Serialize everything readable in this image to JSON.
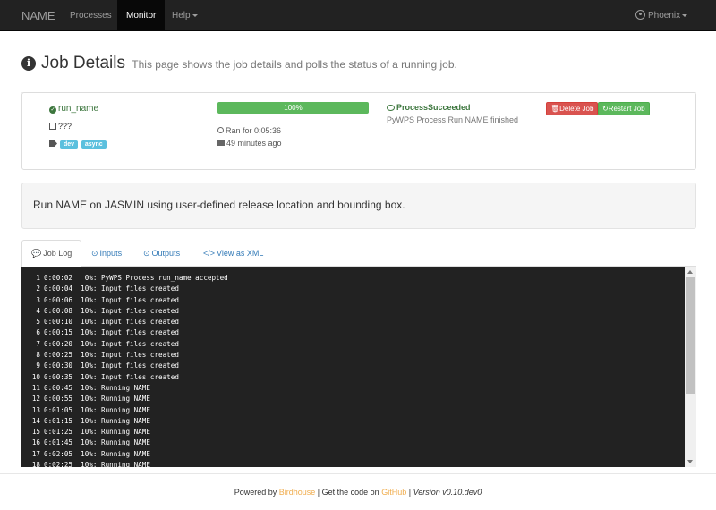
{
  "navbar": {
    "brand": "NAME",
    "processes": "Processes",
    "monitor": "Monitor",
    "help": "Help",
    "user": "Phoenix"
  },
  "header": {
    "title": "Job Details",
    "subtitle": "This page shows the job details and polls the status of a running job."
  },
  "job": {
    "name": "run_name",
    "abstract": "???",
    "tags": [
      "dev",
      "async"
    ],
    "progress": 100,
    "progress_label": "100%",
    "duration": "Ran for 0:05:36",
    "created": "49 minutes ago",
    "status": "ProcessSucceeded",
    "status_message": "PyWPS Process Run NAME finished",
    "delete_label": "Delete Job",
    "restart_label": "Restart Job"
  },
  "description": "Run NAME on JASMIN using user-defined release location and bounding box.",
  "tabs": {
    "log": "Job Log",
    "inputs": "Inputs",
    "outputs": "Outputs",
    "xml": "View as XML"
  },
  "log": [
    {
      "n": "1",
      "time": "0:00:02",
      "msg": " 0%: PyWPS Process run_name accepted"
    },
    {
      "n": "2",
      "time": "0:00:04",
      "msg": "10%: Input files created"
    },
    {
      "n": "3",
      "time": "0:00:06",
      "msg": "10%: Input files created"
    },
    {
      "n": "4",
      "time": "0:00:08",
      "msg": "10%: Input files created"
    },
    {
      "n": "5",
      "time": "0:00:10",
      "msg": "10%: Input files created"
    },
    {
      "n": "6",
      "time": "0:00:15",
      "msg": "10%: Input files created"
    },
    {
      "n": "7",
      "time": "0:00:20",
      "msg": "10%: Input files created"
    },
    {
      "n": "8",
      "time": "0:00:25",
      "msg": "10%: Input files created"
    },
    {
      "n": "9",
      "time": "0:00:30",
      "msg": "10%: Input files created"
    },
    {
      "n": "10",
      "time": "0:00:35",
      "msg": "10%: Input files created"
    },
    {
      "n": "11",
      "time": "0:00:45",
      "msg": "10%: Running NAME"
    },
    {
      "n": "12",
      "time": "0:00:55",
      "msg": "10%: Running NAME"
    },
    {
      "n": "13",
      "time": "0:01:05",
      "msg": "10%: Running NAME"
    },
    {
      "n": "14",
      "time": "0:01:15",
      "msg": "10%: Running NAME"
    },
    {
      "n": "15",
      "time": "0:01:25",
      "msg": "10%: Running NAME"
    },
    {
      "n": "16",
      "time": "0:01:45",
      "msg": "10%: Running NAME"
    },
    {
      "n": "17",
      "time": "0:02:05",
      "msg": "10%: Running NAME"
    },
    {
      "n": "18",
      "time": "0:02:25",
      "msg": "10%: Running NAME"
    }
  ],
  "footer": {
    "powered": "Powered by",
    "birdhouse": "Birdhouse",
    "sep1": "| Get the code on",
    "github": "GitHub",
    "sep2": "|",
    "version": "Version v0.10.dev0"
  },
  "colors": {
    "navbar": "#222222",
    "success": "#5cb85c",
    "danger": "#d9534f",
    "info": "#5bc0de",
    "link": "#337ab7",
    "footer_link": "#f0ad4e"
  }
}
